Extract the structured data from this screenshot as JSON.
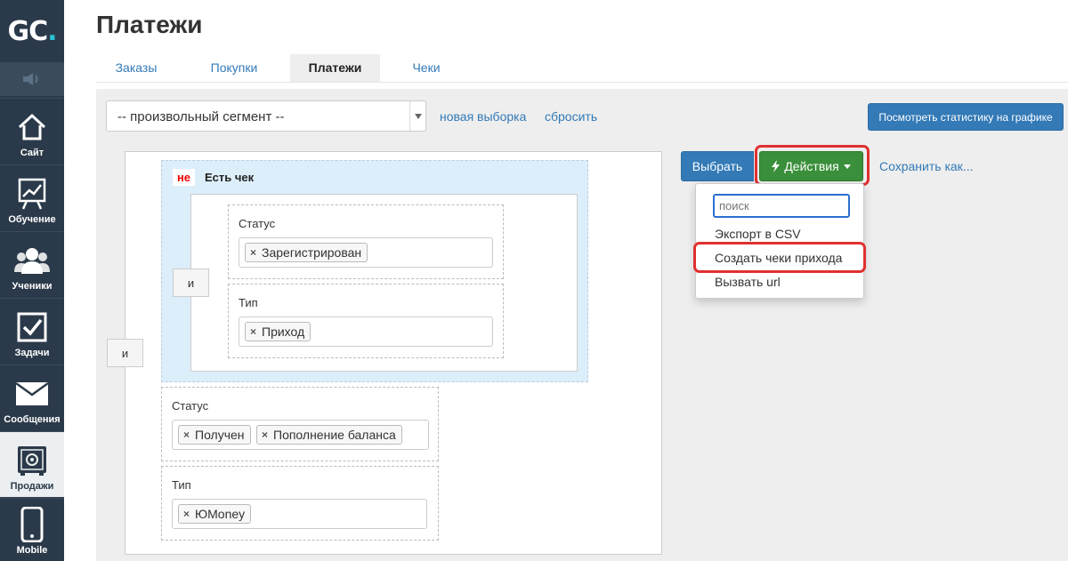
{
  "app": {
    "logo_main": "GC",
    "logo_dot": "."
  },
  "sidebar": {
    "items": [
      {
        "label": "Сайт",
        "icon": "house-icon"
      },
      {
        "label": "Обучение",
        "icon": "chart-board-icon"
      },
      {
        "label": "Ученики",
        "icon": "people-icon"
      },
      {
        "label": "Задачи",
        "icon": "checkbox-icon"
      },
      {
        "label": "Сообщения",
        "icon": "envelope-icon"
      },
      {
        "label": "Продажи",
        "icon": "safe-icon",
        "active": true
      },
      {
        "label": "Mobile",
        "icon": "phone-icon"
      }
    ]
  },
  "header": {
    "title": "Платежи",
    "tabs": [
      "Заказы",
      "Покупки",
      "Платежи",
      "Чеки"
    ],
    "active_tab": "Платежи"
  },
  "toolbar": {
    "segment_value": "-- произвольный сегмент --",
    "new_selection": "новая выборка",
    "reset": "сбросить",
    "stats_button": "Посмотреть статистику на графике"
  },
  "filter": {
    "and_label": "и",
    "not_badge": "не",
    "group_title": "Есть чек",
    "inner_status_label": "Статус",
    "inner_status_tags": [
      "Зарегистрирован"
    ],
    "inner_type_label": "Тип",
    "inner_type_tags": [
      "Приход"
    ],
    "outer_status_label": "Статус",
    "outer_status_tags": [
      "Получен",
      "Пополнение баланса"
    ],
    "outer_type_label": "Тип",
    "outer_type_tags": [
      "ЮMoney"
    ],
    "remove_symbol": "×"
  },
  "actions": {
    "select_button": "Выбрать",
    "actions_button": "Действия",
    "save_as": "Сохранить как...",
    "menu": {
      "search_placeholder": "поиск",
      "items": [
        "Экспорт в CSV",
        "Создать чеки прихода",
        "Вызвать url"
      ]
    }
  },
  "colors": {
    "sidebar": "#2b3a4a",
    "link": "#337ab7",
    "primary": "#337ab7",
    "success": "#3a8f3a",
    "highlight": "#e03030",
    "group_bg": "#ddeefb",
    "negation": "#e00000"
  }
}
